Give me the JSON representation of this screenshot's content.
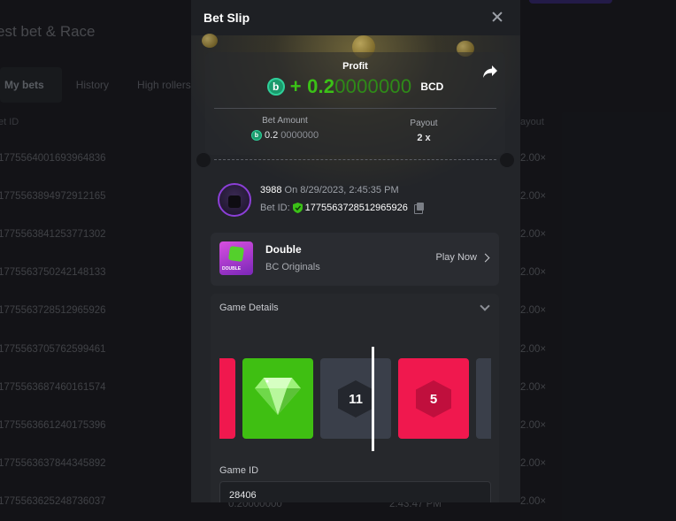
{
  "background": {
    "page_title": "est bet & Race",
    "tabs": [
      {
        "label": "My bets",
        "active": true
      },
      {
        "label": "History",
        "active": false
      },
      {
        "label": "High rollers",
        "active": false
      }
    ],
    "col_bet_id": "et ID",
    "col_payout": "ayout",
    "rows": [
      {
        "id": "1775564001693964836",
        "mult": "2.00×"
      },
      {
        "id": "1775563894972912165",
        "mult": "2.00×"
      },
      {
        "id": "1775563841253771302",
        "mult": "2.00×"
      },
      {
        "id": "1775563750242148133",
        "mult": "2.00×"
      },
      {
        "id": "1775563728512965926",
        "mult": "2.00×"
      },
      {
        "id": "1775563705762599461",
        "mult": "2.00×"
      },
      {
        "id": "1775563687460161574",
        "mult": "2.00×"
      },
      {
        "id": "1775563661240175396",
        "mult": "2.00×"
      },
      {
        "id": "1775563637844345892",
        "mult": "2.00×"
      },
      {
        "id": "1775563625248736037",
        "mult": "2.00×"
      }
    ],
    "last_row_amount": "0.20000000",
    "last_row_time": "2:43:47 PM"
  },
  "modal": {
    "title": "Bet Slip",
    "profit": {
      "label": "Profit",
      "sign": "+",
      "value_main": "0.2",
      "value_faint": "0000000",
      "currency": "BCD"
    },
    "bet_amount": {
      "label": "Bet Amount",
      "value_main": "0.2",
      "value_faint": "0000000"
    },
    "payout": {
      "label": "Payout",
      "value": "2 x"
    },
    "user": {
      "name": "3988",
      "date_prefix": "On",
      "datetime": "8/29/2023, 2:45:35 PM",
      "bet_id_label": "Bet ID:",
      "bet_id": "1775563728512965926"
    },
    "game": {
      "name": "Double",
      "provider": "BC Originals",
      "thumb_tag": "DOUBLE",
      "play_label": "Play Now"
    },
    "details": {
      "title": "Game Details",
      "tiles": [
        {
          "type": "red",
          "label": ""
        },
        {
          "type": "green",
          "label": ""
        },
        {
          "type": "gray",
          "label": "11"
        },
        {
          "type": "red",
          "label": "5"
        },
        {
          "type": "gray",
          "label": ""
        }
      ],
      "game_id_label": "Game ID",
      "game_id": "28406"
    }
  },
  "colors": {
    "accent_green": "#3bc117",
    "tile_red": "#f0184e",
    "tile_green": "#3fbf12",
    "tile_gray": "#3a3f4a"
  }
}
